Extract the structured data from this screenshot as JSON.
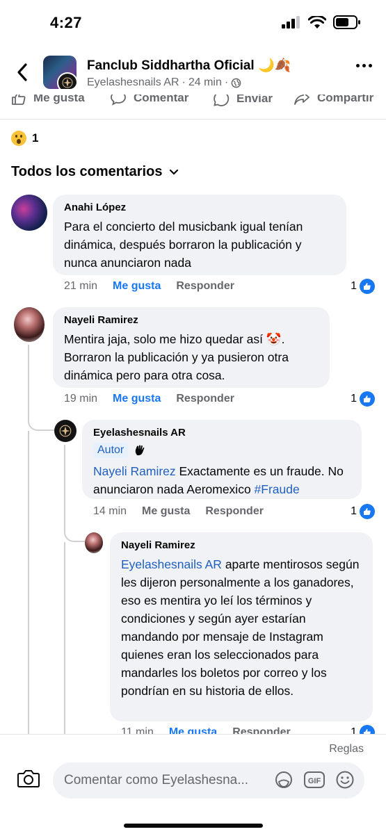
{
  "status_bar": {
    "time": "4:27"
  },
  "header": {
    "group_name": "Fanclub Siddhartha Oficial 🌙🍂",
    "author": "Eyelashesnails AR",
    "time": "24 min",
    "separator": "·"
  },
  "actions": {
    "like": "Me gusta",
    "comment": "Comentar",
    "send": "Enviar",
    "share": "Compartir"
  },
  "reactions": {
    "count": "1"
  },
  "sort": {
    "label": "Todos los comentarios"
  },
  "comments": [
    {
      "author": "Anahi López",
      "text": "Para el concierto del musicbank igual tenían dinámica, después borraron la publicación y nunca anunciaron nada",
      "time": "21 min",
      "like": "Me gusta",
      "reply": "Responder",
      "likes": "1"
    },
    {
      "author": "Nayeli Ramirez",
      "text": "Mentira jaja, solo me hizo quedar así 🤡. Borraron la publicación y ya pusieron otra dinámica pero para otra cosa.",
      "time": "19 min",
      "like": "Me gusta",
      "reply": "Responder",
      "likes": "1"
    },
    {
      "author": "Eyelashesnails AR",
      "badge": "Autor",
      "mention": "Nayeli Ramirez",
      "text": " Exactamente es un fraude. No anunciaron nada Aeromexico ",
      "hashtag": "#Fraude",
      "time": "14 min",
      "like": "Me gusta",
      "reply": "Responder",
      "likes": "1"
    },
    {
      "author": "Nayeli Ramirez",
      "mention": "Eyelashesnails AR",
      "text": " aparte mentirosos según les dijeron personalmente a los ganadores, eso es mentira yo leí los términos y condiciones y según ayer estarían mandando por mensaje de Instagram quienes eran los seleccionados para mandarles los boletos por correo y los pondrían en su historia de ellos.",
      "time": "11 min",
      "like": "Me gusta",
      "reply": "Responder",
      "likes": "1"
    }
  ],
  "footer": {
    "rules": "Reglas",
    "placeholder": "Comentar como Eyelashesna..."
  }
}
